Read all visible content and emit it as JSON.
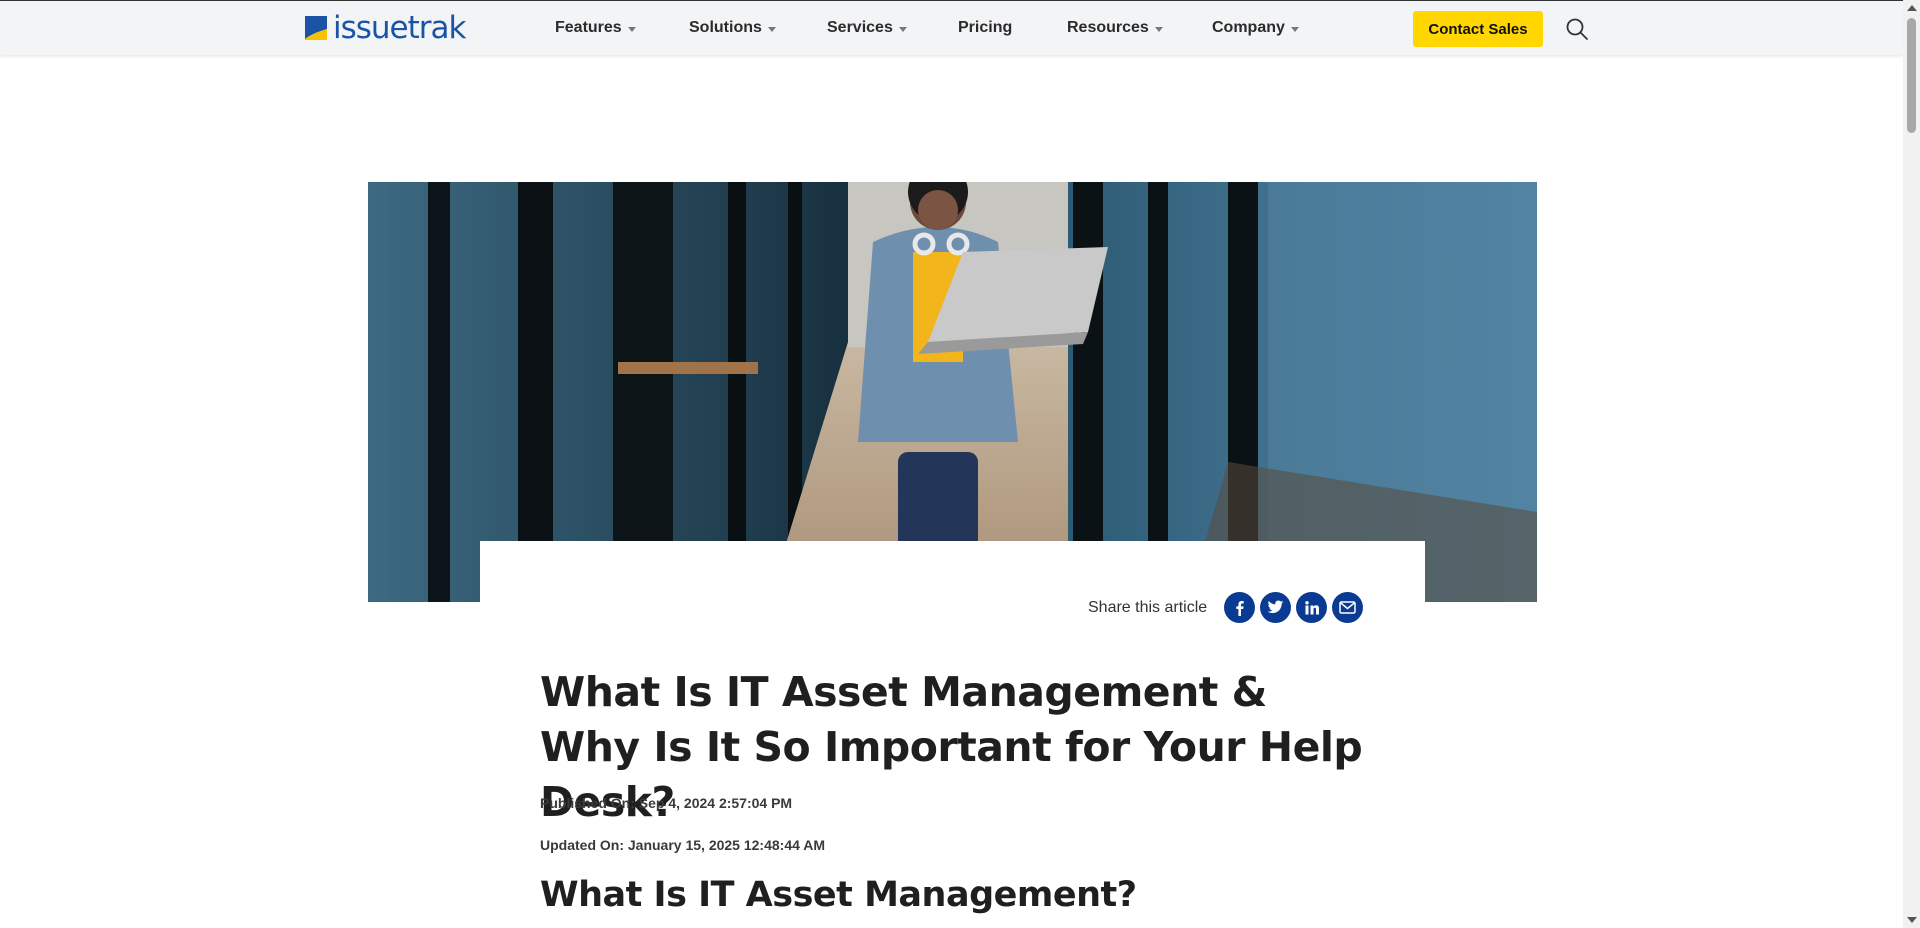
{
  "header": {
    "logo_text": "issuetrak",
    "nav": [
      {
        "label": "Features",
        "dropdown": true
      },
      {
        "label": "Solutions",
        "dropdown": true
      },
      {
        "label": "Services",
        "dropdown": true
      },
      {
        "label": "Pricing",
        "dropdown": false
      },
      {
        "label": "Resources",
        "dropdown": true
      },
      {
        "label": "Company",
        "dropdown": true
      }
    ],
    "cta_label": "Contact Sales",
    "search_icon": "search-icon"
  },
  "article": {
    "share_label": "Share this article",
    "share_icons": [
      "facebook-icon",
      "twitter-icon",
      "linkedin-icon",
      "email-icon"
    ],
    "title": "What Is IT Asset Management & Why Is It So Important for Your Help Desk?",
    "published": "Published On: Sep 4, 2024 2:57:04 PM",
    "updated": "Updated On: January 15, 2025 12:48:44 AM",
    "section_heading": "What Is IT Asset Management?"
  },
  "colors": {
    "brand_blue": "#1b54a6",
    "cta_yellow": "#ffd600",
    "share_blue": "#0a3b93"
  }
}
